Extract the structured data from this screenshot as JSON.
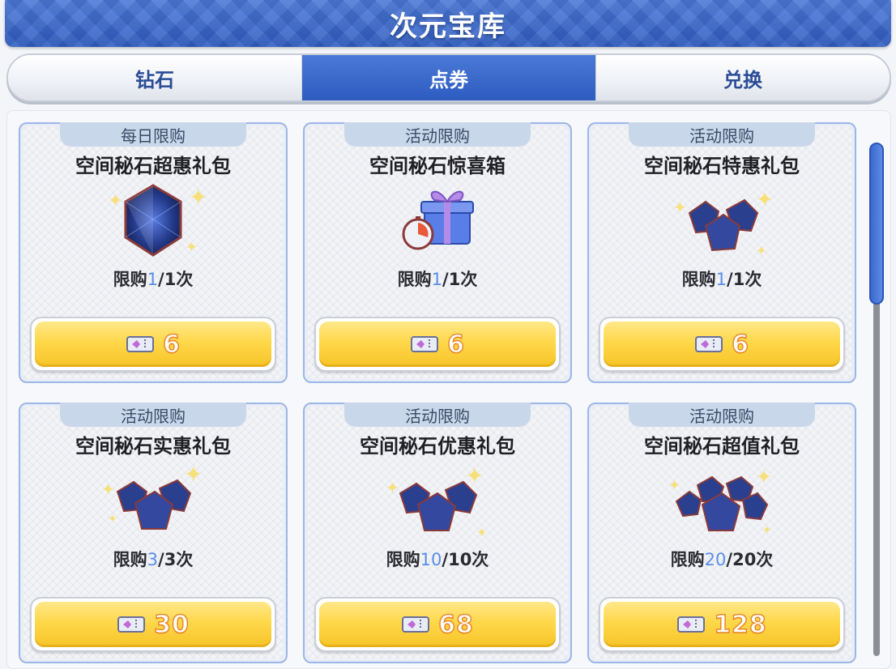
{
  "header": {
    "title": "次元宝库"
  },
  "tabs": [
    {
      "label": "钻石",
      "active": false
    },
    {
      "label": "点券",
      "active": true
    },
    {
      "label": "兑换",
      "active": false
    }
  ],
  "cards": [
    {
      "tag": "每日限购",
      "title": "空间秘石超惠礼包",
      "limit_prefix": "限购",
      "limit_bought": "1",
      "limit_total": "/1次",
      "price": "6",
      "image": "single-gem"
    },
    {
      "tag": "活动限购",
      "title": "空间秘石惊喜箱",
      "limit_prefix": "限购",
      "limit_bought": "1",
      "limit_total": "/1次",
      "price": "6",
      "image": "gift-box"
    },
    {
      "tag": "活动限购",
      "title": "空间秘石特惠礼包",
      "limit_prefix": "限购",
      "limit_bought": "1",
      "limit_total": "/1次",
      "price": "6",
      "image": "gem-cluster"
    },
    {
      "tag": "活动限购",
      "title": "空间秘石实惠礼包",
      "limit_prefix": "限购",
      "limit_bought": "3",
      "limit_total": "/3次",
      "price": "30",
      "image": "gem-cluster"
    },
    {
      "tag": "活动限购",
      "title": "空间秘石优惠礼包",
      "limit_prefix": "限购",
      "limit_bought": "10",
      "limit_total": "/10次",
      "price": "68",
      "image": "gem-cluster"
    },
    {
      "tag": "活动限购",
      "title": "空间秘石超值礼包",
      "limit_prefix": "限购",
      "limit_bought": "20",
      "limit_total": "/20次",
      "price": "128",
      "image": "gem-pile"
    }
  ],
  "colors": {
    "header_blue": "#2f5cc0",
    "price_gold": "#ffd84a",
    "limit_blue": "#5a8ee8"
  },
  "icons": {
    "currency": "ticket-icon"
  },
  "scroll": {
    "position": 0
  }
}
